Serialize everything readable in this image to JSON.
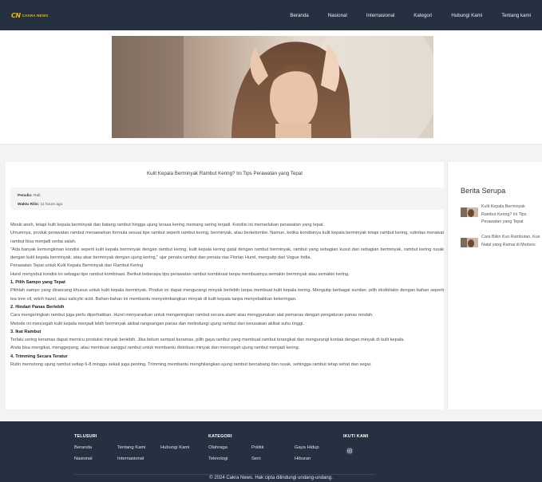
{
  "site": {
    "logo_mark": "CN",
    "logo_text": "CAKRA NEWS"
  },
  "nav": {
    "items": [
      "Beranda",
      "Nasional",
      "Internasional",
      "Kategori",
      "Hubungi Kami",
      "Tentang kami"
    ]
  },
  "article": {
    "title": "Kulit Kepala Berminyak Rambut Kering? Ini Tips Perawatan yang Tepat",
    "meta_author_label": "Penulis:",
    "meta_author_value": "Rafi",
    "meta_time_label": "Waktu Rilis:",
    "meta_time_value": "11 hours ago",
    "paragraphs": [
      "Meski aneh, tetapi kulit kepala berminyak dan batang rambut hingga ujung terasa kering memang sering terjadi. Kondisi ini memerlukan perawatan yang tepat.",
      "Umumnya, produk perawatan rambut menawarkan formula sesuai tipe rambut seperti rambut kering, berminyak, atau berketombe. Namun, ketika kondisinya kulit kepala berminyak tetapi rambut kering, rutinitas merawat rambut bisa menjadi serba salah.",
      "\"Ada banyak kemungkinan kondisi seperti kulit kepala berminyak dengan rambut kering, kulit kepala kering gatal dengan rambut berminyak, rambut yang sebagian kusut dan sebagian berminyak, rambut kering rusak dengan kulit kepala berminyak, atau akar berminyak dengan ujung kering,\" ujar penata rambut dan penata rias Florian Hurel, mengutip dari Vogue India.",
      "Perawatan Tepat untuk Kulit Kepala Berminyak dan Rambut Kering",
      "Hurel menyebut kondisi ini sebagai tipe rambut kombinasi. Berikut beberapa tips perawatan rambut kombinasi tanpa membuatnya semakin berminyak atau semakin kering.",
      "1. Pilih Sampo yang Tepat",
      "Pilihlah sampo yang dirancang khusus untuk kulit kepala berminyak. Produk ini dapat mengurangi minyak berlebih tanpa membuat kulit kepala kering. Mengutip berbagai sumber, pilih eksfoliator dengan bahan seperti tea tree oil, witch hazel, atau salicylic acid. Bahan-bahan ini membantu menyeimbangkan minyak di kulit kepala tanpa menyebabkan kekeringan.",
      "2. Hindari Panas Berlebih",
      "Cara mengeringkan rambut juga perlu diperhatikan. Hurel menyarankan untuk mengeringkan rambut secara alami atau menggunakan alat pemanas dengan pengaturan panas rendah.",
      "Metode ini mencegah kulit kepala menjadi lebih berminyak akibat rangsangan panas dan melindungi ujung rambut dari kerusakan akibat suhu tinggi.",
      "3. Ikat Rambut",
      "Terlalu sering keramas dapat memicu produksi minyak berlebih. Jika belum sempat keramas, pilih gaya rambut yang membuat rambut terangkat dan mengurangi kontak dengan minyak di kulit kepala.",
      "Anda bisa mengikat, menggepang, atau membuat sanggul rambut untuk membantu distribusi minyak dan mencegah ujung rambut menjadi kering.",
      "4. Trimming Secara Teratur",
      "Rutin memotong ujung rambut setiap 6-8 minggu sekali juga penting. Trimming membantu menghilangkan ujung rambut bercabang dan rusak, sehingga rambut tetap sehat dan segar."
    ]
  },
  "sidebar": {
    "title": "Berita Serupa",
    "items": [
      "Kulit Kepala Berminyak Rambut Kering? Ini Tips Perawatan yang Tepat",
      "Cara Bikin Kuo Rambutan, Kue Natal yang Ramai di Medsos"
    ]
  },
  "footer": {
    "col1_title": "TELUSURI",
    "col1_links": [
      "Beranda",
      "Tentang Kami",
      "Hubungi Kami",
      "Nasional",
      "Internasional"
    ],
    "col2_title": "KATEGORI",
    "col2_links": [
      "Olahraga",
      "Politik",
      "Gaya Hidup",
      "Teknologi",
      "Seni",
      "Hiburan"
    ],
    "col3_title": "IKUTI KAMI",
    "copyright": "© 2024 Cakra News. Hak cipta dilindungi undang-undang."
  }
}
